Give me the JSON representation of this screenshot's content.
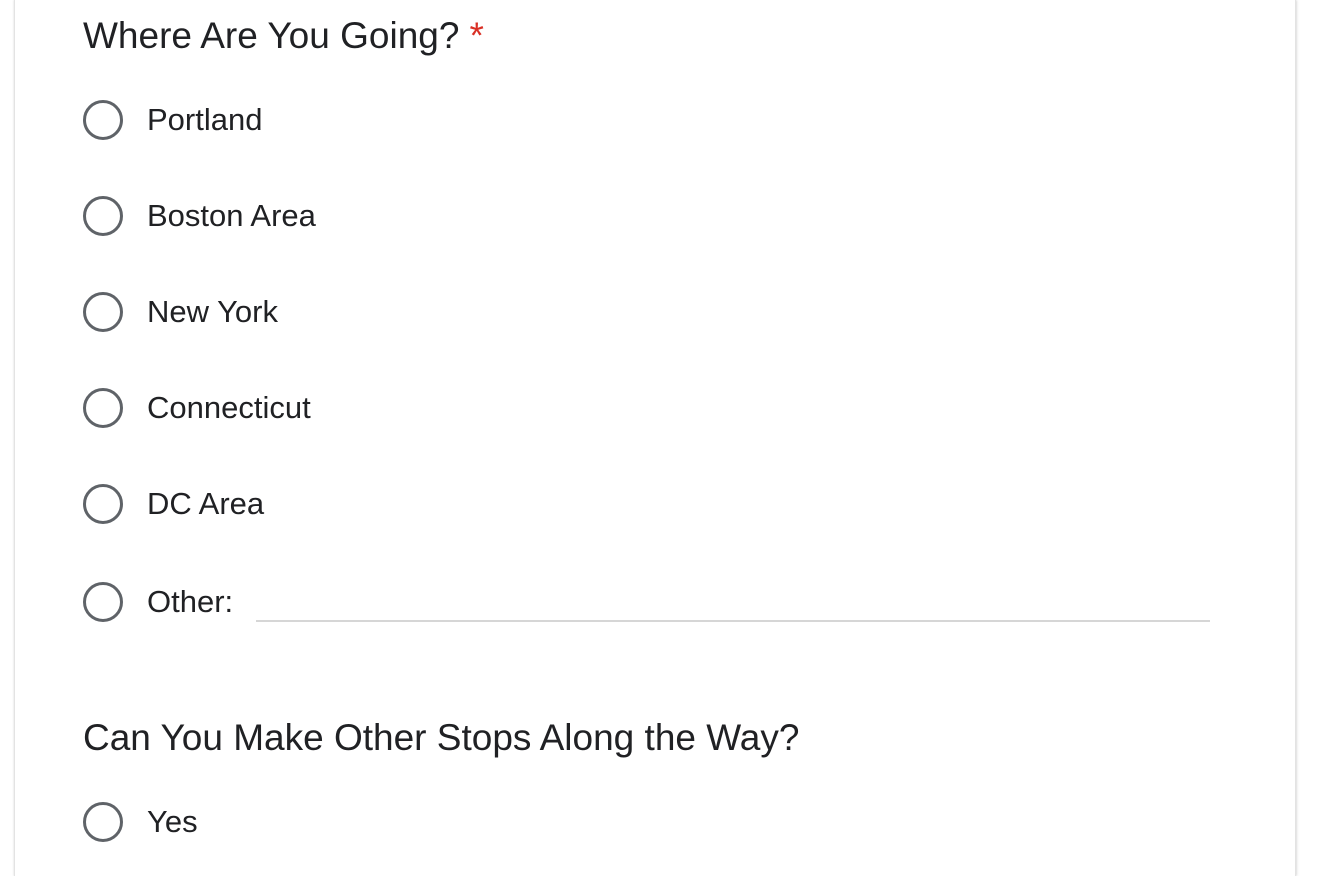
{
  "questions": [
    {
      "title": "Where Are You Going?",
      "required_mark": "*",
      "options": [
        {
          "label": "Portland"
        },
        {
          "label": "Boston Area"
        },
        {
          "label": "New York"
        },
        {
          "label": "Connecticut"
        },
        {
          "label": "DC Area"
        },
        {
          "label": "Other:"
        }
      ],
      "other_input": {
        "value": "",
        "placeholder": ""
      }
    },
    {
      "title": "Can You Make Other Stops Along the Way?",
      "options": [
        {
          "label": "Yes"
        }
      ]
    }
  ],
  "colors": {
    "required": "#d93025",
    "radio_border": "#5f6368",
    "text": "#202124",
    "input_underline": "#d6d6d6"
  }
}
